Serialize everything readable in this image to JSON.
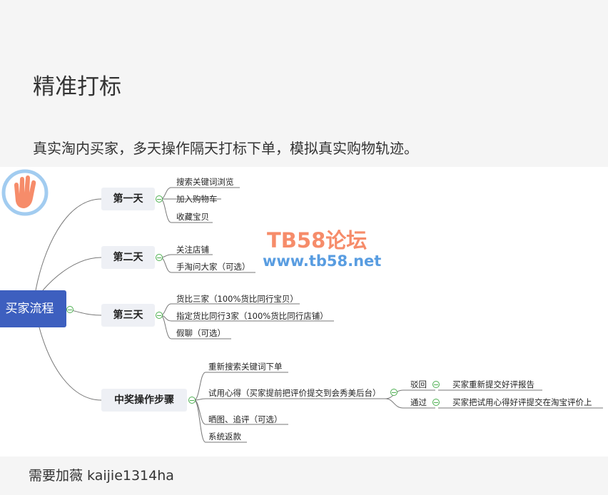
{
  "header": {
    "title": "精准打标",
    "description": "真实淘内买家，多天操作隔天打标下单，模拟真实购物轨迹。"
  },
  "mindmap": {
    "root": "买家流程",
    "branches": [
      {
        "label": "第一天",
        "items": [
          "搜索关键词浏览",
          "加入购物车",
          "收藏宝贝"
        ]
      },
      {
        "label": "第二天",
        "items": [
          "关注店铺",
          "手淘问大家（可选）"
        ]
      },
      {
        "label": "第三天",
        "items": [
          "货比三家（100%货比同行宝贝）",
          "指定货比同行3家（100%货比同行店铺）",
          "假聊（可选）"
        ]
      },
      {
        "label": "中奖操作步骤",
        "items": [
          "重新搜索关键词下单",
          "试用心得（买家提前把评价提交到会秀美后台）",
          "晒图、追评（可选）",
          "系统返款"
        ],
        "sub": [
          {
            "label": "驳回",
            "result": "买家重新提交好评报告"
          },
          {
            "label": "通过",
            "result": "买家把试用心得好评提交在淘宝评价上"
          }
        ]
      }
    ]
  },
  "watermark": {
    "name": "TB58论坛",
    "url": "www.tb58.net"
  },
  "footer": {
    "contact": "需要加薇 kaijie1314ha"
  }
}
